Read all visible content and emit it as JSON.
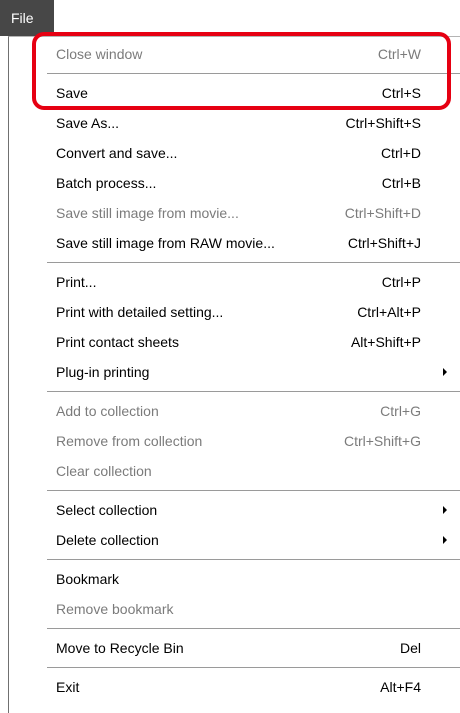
{
  "menubar": {
    "file_label": "File"
  },
  "groups": [
    {
      "items": [
        {
          "label": "Close window",
          "shortcut": "Ctrl+W",
          "disabled": true
        }
      ]
    },
    {
      "items": [
        {
          "label": "Save",
          "shortcut": "Ctrl+S",
          "disabled": false
        },
        {
          "label": "Save As...",
          "shortcut": "Ctrl+Shift+S",
          "disabled": false
        },
        {
          "label": "Convert and save...",
          "shortcut": "Ctrl+D",
          "disabled": false
        },
        {
          "label": "Batch process...",
          "shortcut": "Ctrl+B",
          "disabled": false
        },
        {
          "label": "Save still image from movie...",
          "shortcut": "Ctrl+Shift+D",
          "disabled": true
        },
        {
          "label": "Save still image from RAW movie...",
          "shortcut": "Ctrl+Shift+J",
          "disabled": false
        }
      ]
    },
    {
      "items": [
        {
          "label": "Print...",
          "shortcut": "Ctrl+P",
          "disabled": false
        },
        {
          "label": "Print with detailed setting...",
          "shortcut": "Ctrl+Alt+P",
          "disabled": false
        },
        {
          "label": "Print contact sheets",
          "shortcut": "Alt+Shift+P",
          "disabled": false
        },
        {
          "label": "Plug-in printing",
          "shortcut": "",
          "disabled": false,
          "submenu": true
        }
      ]
    },
    {
      "items": [
        {
          "label": "Add to collection",
          "shortcut": "Ctrl+G",
          "disabled": true
        },
        {
          "label": "Remove from collection",
          "shortcut": "Ctrl+Shift+G",
          "disabled": true
        },
        {
          "label": "Clear collection",
          "shortcut": "",
          "disabled": true
        }
      ]
    },
    {
      "items": [
        {
          "label": "Select collection",
          "shortcut": "",
          "disabled": false,
          "submenu": true
        },
        {
          "label": "Delete collection",
          "shortcut": "",
          "disabled": false,
          "submenu": true
        }
      ]
    },
    {
      "items": [
        {
          "label": "Bookmark",
          "shortcut": "",
          "disabled": false
        },
        {
          "label": "Remove bookmark",
          "shortcut": "",
          "disabled": true
        }
      ]
    },
    {
      "items": [
        {
          "label": "Move to Recycle Bin",
          "shortcut": "Del",
          "disabled": false
        }
      ]
    },
    {
      "items": [
        {
          "label": "Exit",
          "shortcut": "Alt+F4",
          "disabled": false
        }
      ]
    }
  ],
  "colors": {
    "highlight_border": "#e60012",
    "menubar_tab": "#474747",
    "disabled_text": "#7b7b7b"
  }
}
